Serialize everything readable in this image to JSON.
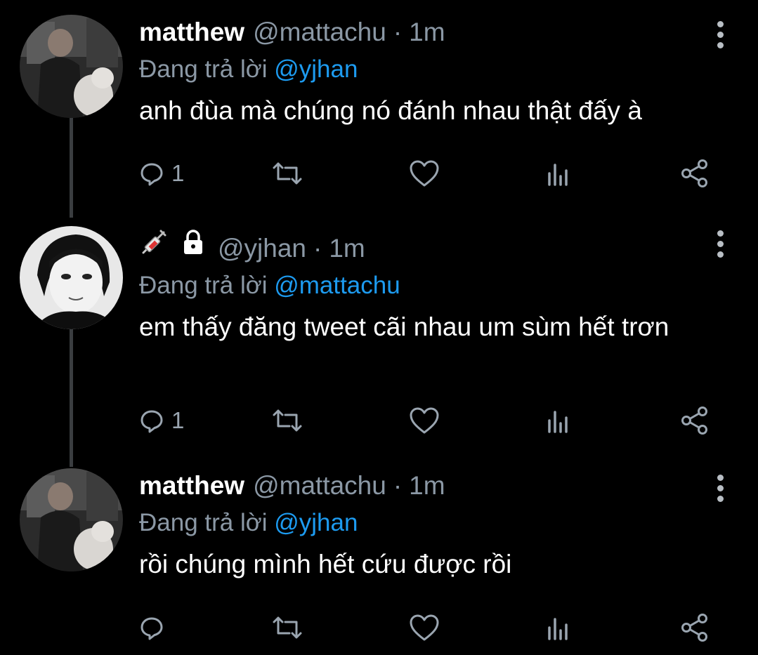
{
  "tweets": [
    {
      "name": "matthew",
      "handle": "@mattachu",
      "dot": "·",
      "time": "1m",
      "reply_prefix": "Đang trả lời",
      "reply_to": "@yjhan",
      "text": "anh đùa mà chúng nó đánh nhau thật đấy à",
      "reply_count": "1"
    },
    {
      "name": "",
      "emoji": "syringe-icon",
      "locked": true,
      "handle": "@yjhan",
      "dot": "·",
      "time": "1m",
      "reply_prefix": "Đang trả lời",
      "reply_to": "@mattachu",
      "text": "em thấy đăng tweet cãi nhau um sùm hết trơn",
      "reply_count": "1"
    },
    {
      "name": "matthew",
      "handle": "@mattachu",
      "dot": "·",
      "time": "1m",
      "reply_prefix": "Đang trả lời",
      "reply_to": "@yjhan",
      "text": "rồi chúng mình hết cứu được rồi",
      "reply_count": ""
    }
  ],
  "colors": {
    "background": "#000000",
    "mention": "#1d9bf0",
    "secondary": "#8b98a5",
    "thread_line": "#3a3d40"
  }
}
